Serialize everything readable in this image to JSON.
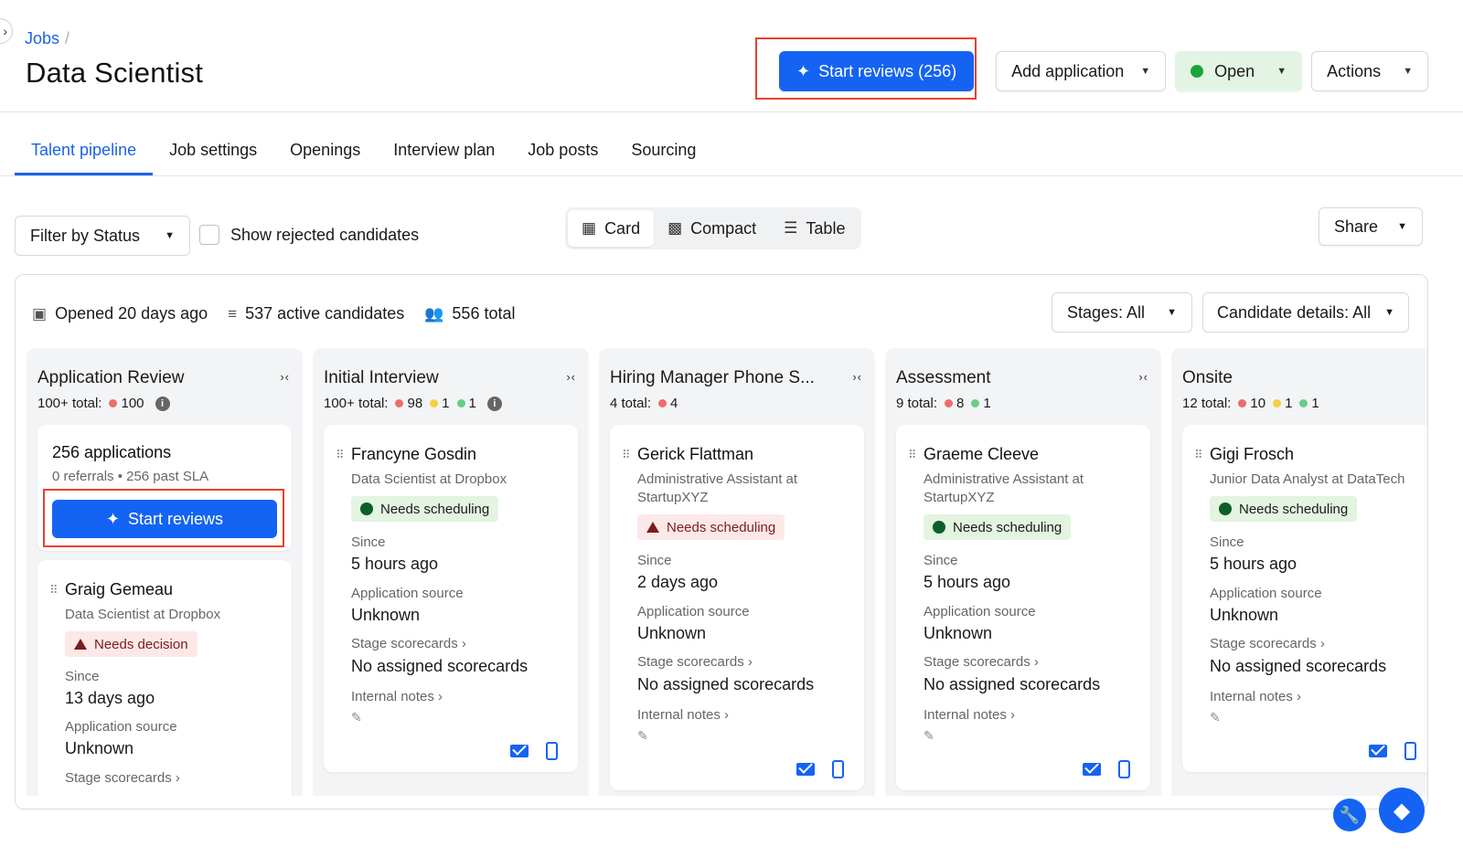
{
  "breadcrumb": {
    "root": "Jobs",
    "separator": "/"
  },
  "page_title": "Data Scientist",
  "header_actions": {
    "start_reviews": "Start reviews (256)",
    "add_application": "Add application",
    "status": "Open",
    "actions": "Actions"
  },
  "tabs": [
    "Talent pipeline",
    "Job settings",
    "Openings",
    "Interview plan",
    "Job posts",
    "Sourcing"
  ],
  "active_tab": "Talent pipeline",
  "filters": {
    "status_filter": "Filter by Status",
    "show_rejected": "Show rejected candidates"
  },
  "views": [
    "Card",
    "Compact",
    "Table"
  ],
  "active_view": "Card",
  "share": "Share",
  "stats": {
    "opened": "Opened 20 days ago",
    "active": "537 active candidates",
    "total": "556 total"
  },
  "stages_filter": "Stages: All",
  "details_filter": "Candidate details: All",
  "columns": [
    {
      "title": "Application Review",
      "total": "100+ total:",
      "counts": [
        "100"
      ],
      "apps_card": {
        "title": "256 applications",
        "sub": "0 referrals • 256 past SLA",
        "button": "Start reviews"
      },
      "candidate": {
        "name": "Graig Gemeau",
        "role": "Data Scientist at Dropbox",
        "badge": "Needs decision",
        "since_label": "Since",
        "since": "13 days ago",
        "source_label": "Application source",
        "source": "Unknown",
        "scorecards_label": "Stage scorecards ›"
      }
    },
    {
      "title": "Initial Interview",
      "total": "100+ total:",
      "counts": [
        "98",
        "1",
        "1"
      ],
      "candidate": {
        "name": "Francyne Gosdin",
        "role": "Data Scientist at Dropbox",
        "badge": "Needs scheduling",
        "since_label": "Since",
        "since": "5 hours ago",
        "source_label": "Application source",
        "source": "Unknown",
        "scorecards_label": "Stage scorecards ›",
        "scorecards": "No assigned scorecards",
        "notes_label": "Internal notes ›"
      }
    },
    {
      "title": "Hiring Manager Phone S...",
      "total": "4 total:",
      "counts": [
        "4"
      ],
      "candidate": {
        "name": "Gerick Flattman",
        "role": "Administrative Assistant at StartupXYZ",
        "badge": "Needs scheduling",
        "since_label": "Since",
        "since": "2 days ago",
        "source_label": "Application source",
        "source": "Unknown",
        "scorecards_label": "Stage scorecards ›",
        "scorecards": "No assigned scorecards",
        "notes_label": "Internal notes ›"
      }
    },
    {
      "title": "Assessment",
      "total": "9 total:",
      "counts": [
        "8",
        "1"
      ],
      "candidate": {
        "name": "Graeme Cleeve",
        "role": "Administrative Assistant at StartupXYZ",
        "badge": "Needs scheduling",
        "since_label": "Since",
        "since": "5 hours ago",
        "source_label": "Application source",
        "source": "Unknown",
        "scorecards_label": "Stage scorecards ›",
        "scorecards": "No assigned scorecards",
        "notes_label": "Internal notes ›"
      }
    },
    {
      "title": "Onsite",
      "total": "12 total:",
      "counts": [
        "10",
        "1",
        "1"
      ],
      "candidate": {
        "name": "Gigi Frosch",
        "role": "Junior Data Analyst at DataTech",
        "badge": "Needs scheduling",
        "since_label": "Since",
        "since": "5 hours ago",
        "source_label": "Application source",
        "source": "Unknown",
        "scorecards_label": "Stage scorecards ›",
        "scorecards": "No assigned scorecards",
        "notes_label": "Internal notes ›"
      }
    }
  ],
  "colors": {
    "primary": "#1463f3",
    "link": "#1a63e8",
    "highlight": "#e8412c",
    "open_status": "#1ba43a"
  }
}
